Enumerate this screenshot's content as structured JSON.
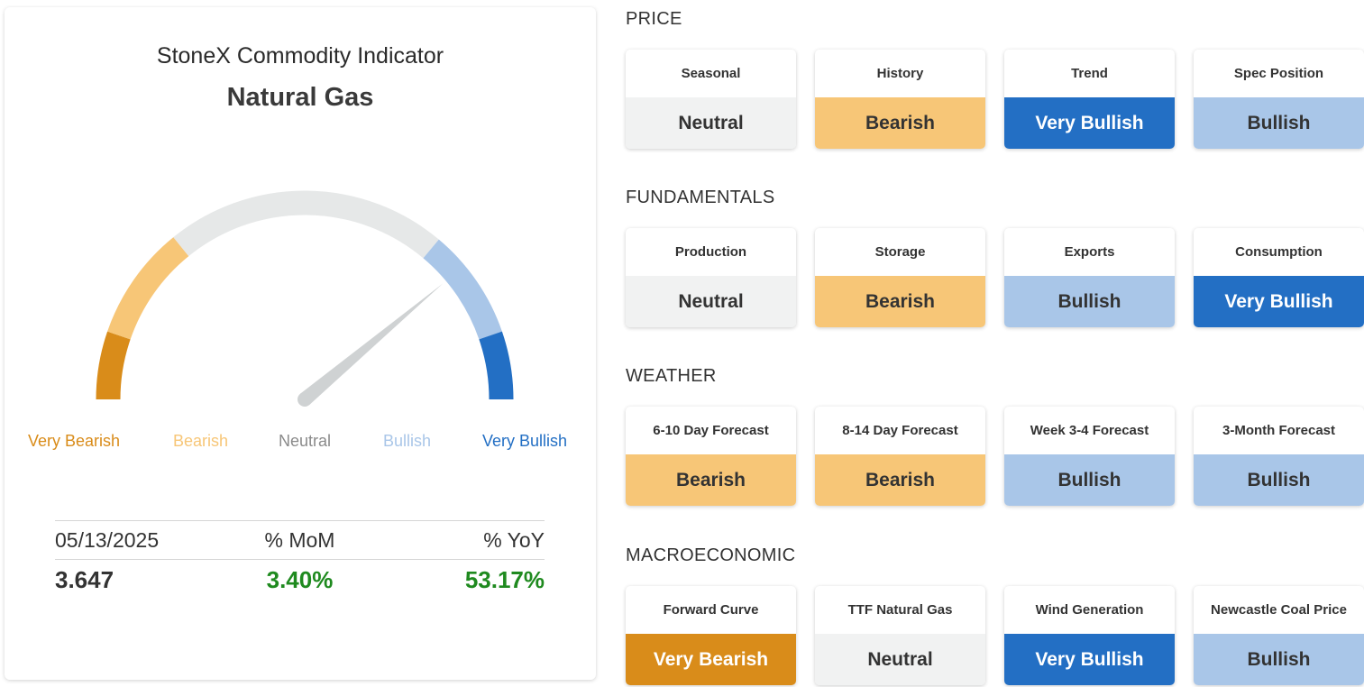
{
  "header": {
    "title": "StoneX Commodity Indicator",
    "commodity": "Natural Gas"
  },
  "colors": {
    "very_bearish": "#d98c1a",
    "bearish": "#f7c677",
    "neutral": "#e6e8e8",
    "bullish": "#a9c6e8",
    "very_bullish": "#236fc4",
    "needle": "#cfd2d3",
    "positive": "#1f8a1f"
  },
  "gauge": {
    "reading": "Bullish",
    "labels": [
      {
        "text": "Very Bearish",
        "color": "#d98c1a"
      },
      {
        "text": "Bearish",
        "color": "#f7c677"
      },
      {
        "text": "Neutral",
        "color": "#8a8a8a"
      },
      {
        "text": "Bullish",
        "color": "#a9c6e8"
      },
      {
        "text": "Very Bullish",
        "color": "#236fc4"
      }
    ]
  },
  "stats": {
    "date": "05/13/2025",
    "mom_label": "% MoM",
    "yoy_label": "% YoY",
    "price": "3.647",
    "mom": "3.40%",
    "yoy": "53.17%"
  },
  "sections": [
    {
      "title": "PRICE",
      "items": [
        {
          "label": "Seasonal",
          "value": "Neutral",
          "rating": "neutral"
        },
        {
          "label": "History",
          "value": "Bearish",
          "rating": "bearish"
        },
        {
          "label": "Trend",
          "value": "Very Bullish",
          "rating": "very_bullish"
        },
        {
          "label": "Spec Position",
          "value": "Bullish",
          "rating": "bullish"
        }
      ]
    },
    {
      "title": "FUNDAMENTALS",
      "items": [
        {
          "label": "Production",
          "value": "Neutral",
          "rating": "neutral"
        },
        {
          "label": "Storage",
          "value": "Bearish",
          "rating": "bearish"
        },
        {
          "label": "Exports",
          "value": "Bullish",
          "rating": "bullish"
        },
        {
          "label": "Consumption",
          "value": "Very Bullish",
          "rating": "very_bullish"
        }
      ]
    },
    {
      "title": "WEATHER",
      "items": [
        {
          "label": "6-10 Day Forecast",
          "value": "Bearish",
          "rating": "bearish"
        },
        {
          "label": "8-14 Day Forecast",
          "value": "Bearish",
          "rating": "bearish"
        },
        {
          "label": "Week 3-4 Forecast",
          "value": "Bullish",
          "rating": "bullish"
        },
        {
          "label": "3-Month Forecast",
          "value": "Bullish",
          "rating": "bullish"
        }
      ]
    },
    {
      "title": "MACROECONOMIC",
      "items": [
        {
          "label": "Forward Curve",
          "value": "Very Bearish",
          "rating": "very_bearish"
        },
        {
          "label": "TTF Natural Gas",
          "value": "Neutral",
          "rating": "neutral"
        },
        {
          "label": "Wind Generation",
          "value": "Very Bullish",
          "rating": "very_bullish"
        },
        {
          "label": "Newcastle Coal Price",
          "value": "Bullish",
          "rating": "bullish"
        }
      ]
    }
  ]
}
